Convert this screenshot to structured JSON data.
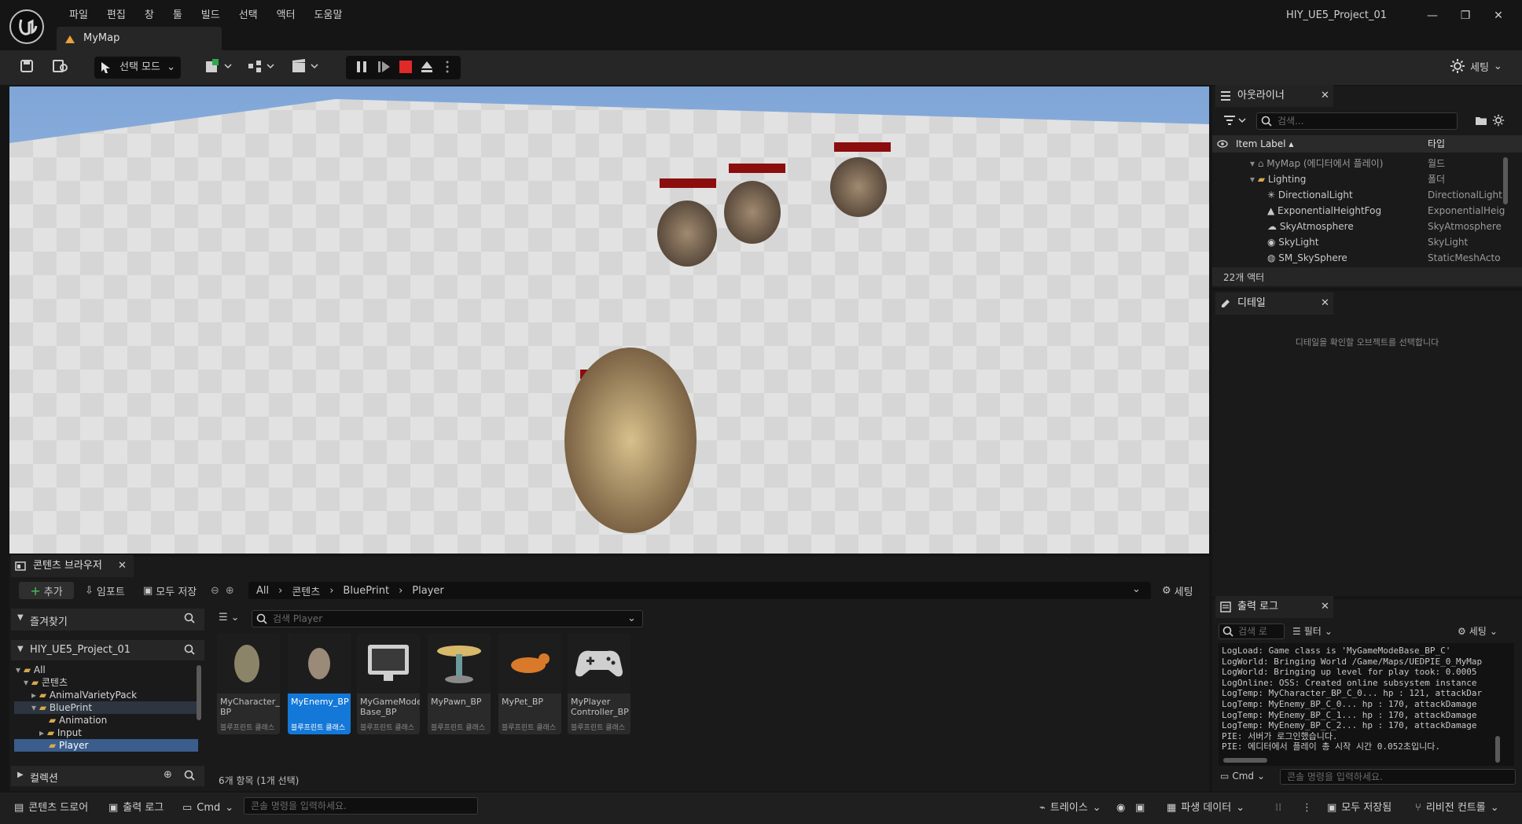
{
  "app": {
    "project_title": "HIY_UE5_Project_01",
    "map_tab": "MyMap",
    "menu": [
      "파일",
      "편집",
      "창",
      "툴",
      "빌드",
      "선택",
      "액터",
      "도움말"
    ]
  },
  "toolbar": {
    "mode_label": "선택 모드",
    "settings_label": "세팅"
  },
  "outliner": {
    "tab_label": "아웃라이너",
    "search_placeholder": "검색...",
    "col_label": "Item Label",
    "col_type": "타입",
    "rows": [
      {
        "label": "MyMap (에디터에서 플레이)",
        "type": "월드"
      },
      {
        "label": "Lighting",
        "type": "폴더"
      },
      {
        "label": "DirectionalLight",
        "type": "DirectionalLight"
      },
      {
        "label": "ExponentialHeightFog",
        "type": "ExponentialHeig"
      },
      {
        "label": "SkyAtmosphere",
        "type": "SkyAtmosphere"
      },
      {
        "label": "SkyLight",
        "type": "SkyLight"
      },
      {
        "label": "SM_SkySphere",
        "type": "StaticMeshActo"
      }
    ],
    "count": "22개 액터"
  },
  "details": {
    "tab_label": "디테일",
    "empty_text": "디테일을 확인할 오브젝트를 선택합니다"
  },
  "content_browser": {
    "tab_label": "콘텐츠 브라우저",
    "add_label": "추가",
    "import_label": "임포트",
    "save_all_label": "모두 저장",
    "settings_label": "세팅",
    "breadcrumb": [
      "All",
      "콘텐츠",
      "BluePrint",
      "Player"
    ],
    "favorites_label": "즐겨찾기",
    "project_label": "HIY_UE5_Project_01",
    "tree": [
      "All",
      "콘텐츠",
      "AnimalVarietyPack",
      "BluePrint",
      "Animation",
      "Input",
      "Player"
    ],
    "collections_label": "컬렉션",
    "search_placeholder": "검색 Player",
    "assets": [
      {
        "name": "MyCharacter_\nBP",
        "type": "블루프린트 클래스"
      },
      {
        "name": "MyEnemy_BP",
        "type": "블루프린트 클래스"
      },
      {
        "name": "MyGameMode\nBase_BP",
        "type": "블루프린트 클래스"
      },
      {
        "name": "MyPawn_BP",
        "type": "블루프린트 클래스"
      },
      {
        "name": "MyPet_BP",
        "type": "블루프린트 클래스"
      },
      {
        "name": "MyPlayer\nController_BP",
        "type": "블루프린트 클래스"
      }
    ],
    "item_count": "6개 항목 (1개 선택)"
  },
  "output_log": {
    "tab_label": "출력 로그",
    "search_placeholder": "검색 로",
    "filter_label": "필터",
    "settings_label": "세팅",
    "lines": [
      "LogLoad: Game class is 'MyGameModeBase_BP_C'",
      "LogWorld: Bringing World /Game/Maps/UEDPIE_0_MyMap",
      "LogWorld: Bringing up level for play took: 0.0005",
      "LogOnline: OSS: Created online subsystem instance",
      "LogTemp: MyCharacter_BP_C_0... hp : 121, attackDar",
      "LogTemp: MyEnemy_BP_C_0... hp : 170, attackDamage",
      "LogTemp: MyEnemy_BP_C_1... hp : 170, attackDamage",
      "LogTemp: MyEnemy_BP_C_2... hp : 170, attackDamage",
      "PIE: 서버가 로그인했습니다.",
      "PIE: 에디터에서 플레이 총 시작 시간 0.052초입니다."
    ],
    "cmd_label": "Cmd",
    "cmd_placeholder": "콘솔 명령을 입력하세요."
  },
  "statusbar": {
    "content_drawer": "콘텐츠 드로어",
    "output_log": "출력 로그",
    "cmd": "Cmd",
    "cmd_placeholder": "콘솔 명령을 입력하세요.",
    "trace": "트레이스",
    "derived_data": "파생 데이터",
    "save_all": "모두 저장됨",
    "revision_control": "리비전 컨트롤"
  },
  "colors": {
    "accent": "#1478d8",
    "play_stop": "#e02a2a",
    "health_bar": "#8b0d0d"
  }
}
